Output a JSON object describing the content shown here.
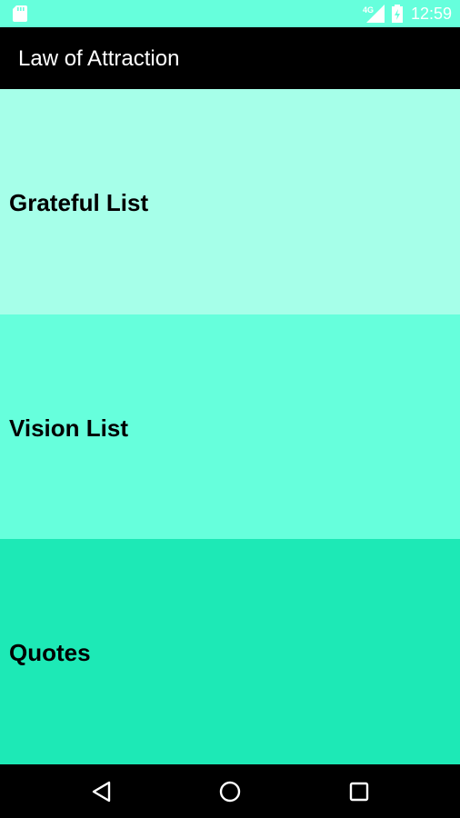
{
  "status_bar": {
    "time": "12:59",
    "network": "4G",
    "icons": [
      "sd-card-icon",
      "signal-icon",
      "battery-icon"
    ],
    "color": "#66FFDC"
  },
  "app_bar": {
    "title": "Law of Attraction",
    "color": "#000000"
  },
  "menu": {
    "items": [
      {
        "label": "Grateful List",
        "color": "#A6FFE9"
      },
      {
        "label": "Vision List",
        "color": "#66FFDC"
      },
      {
        "label": "Quotes",
        "color": "#1DE9B6"
      }
    ]
  },
  "nav_bar": {
    "buttons": [
      "back-icon",
      "home-icon",
      "recents-icon"
    ]
  }
}
